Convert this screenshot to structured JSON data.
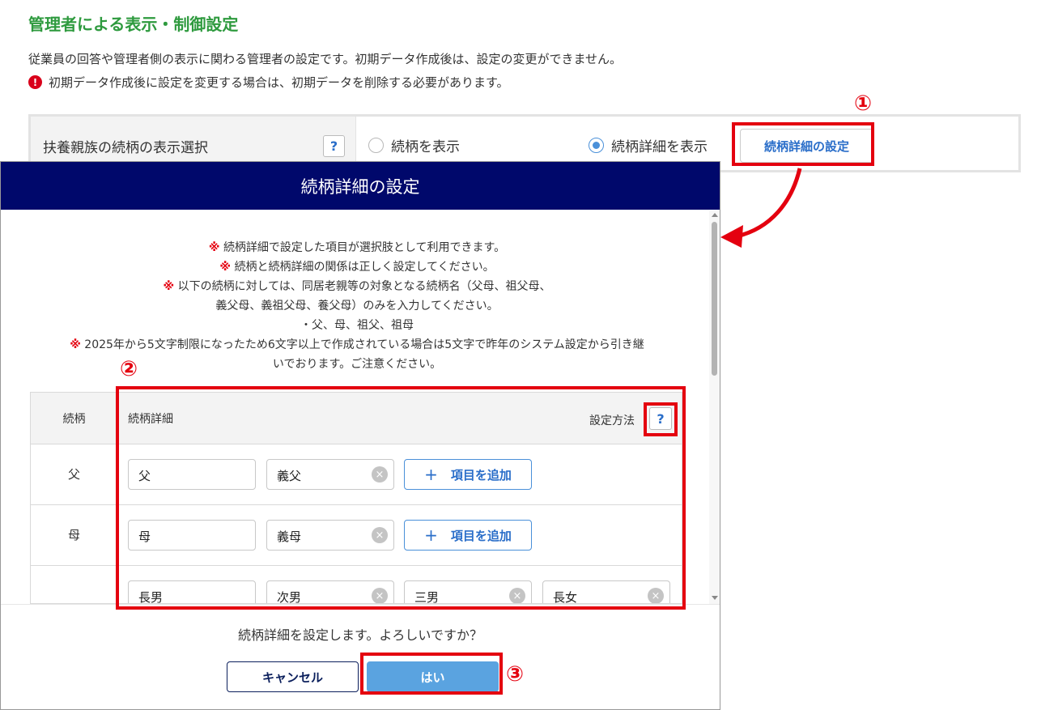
{
  "page": {
    "title": "管理者による表示・制御設定",
    "description": "従業員の回答や管理者側の表示に関わる管理者の設定です。初期データ作成後は、設定の変更ができません。",
    "warning_icon": "!",
    "warning": "初期データ作成後に設定を変更する場合は、初期データを削除する必要があります。"
  },
  "setting": {
    "label": "扶養親族の続柄の表示選択",
    "help": "?",
    "option_relationship": "続柄を表示",
    "option_detail": "続柄詳細を表示",
    "selected": "続柄詳細を表示",
    "detail_button": "続柄詳細の設定"
  },
  "markers": {
    "one": "①",
    "two": "②",
    "three": "③"
  },
  "modal": {
    "title": "続柄詳細の設定",
    "note_mark": "※",
    "notes": [
      "続柄詳細で設定した項目が選択肢として利用できます。",
      "続柄と続柄詳細の関係は正しく設定してください。",
      "以下の続柄に対しては、同居老親等の対象となる続柄名（父母、祖父母、",
      "義父母、義祖父母、養父母）のみを入力してください。",
      "・父、母、祖父、祖母",
      "2025年から5文字制限になったため6文字以上で作成されている場合は5文字で昨年のシステム設定から引き継",
      "いでおります。ご注意ください。"
    ],
    "table": {
      "col_relationship": "続柄",
      "col_detail": "続柄詳細",
      "col_method": "設定方法",
      "help": "?",
      "add_label": "項目を追加",
      "add_plus": "+",
      "clear_glyph": "×",
      "rows": [
        {
          "label": "父",
          "values": [
            "父",
            "義父"
          ]
        },
        {
          "label": "母",
          "values": [
            "母",
            "義母"
          ]
        },
        {
          "label": "",
          "values": [
            "長男",
            "次男",
            "三男",
            "長女"
          ]
        }
      ]
    },
    "confirm": "続柄詳細を設定します。よろしいですか？",
    "cancel": "キャンセル",
    "ok": "はい"
  },
  "colors": {
    "title_green": "#2e9a3e",
    "header_navy": "#00086b",
    "annotation_red": "#e4000f",
    "button_blue": "#5aa3e0"
  }
}
